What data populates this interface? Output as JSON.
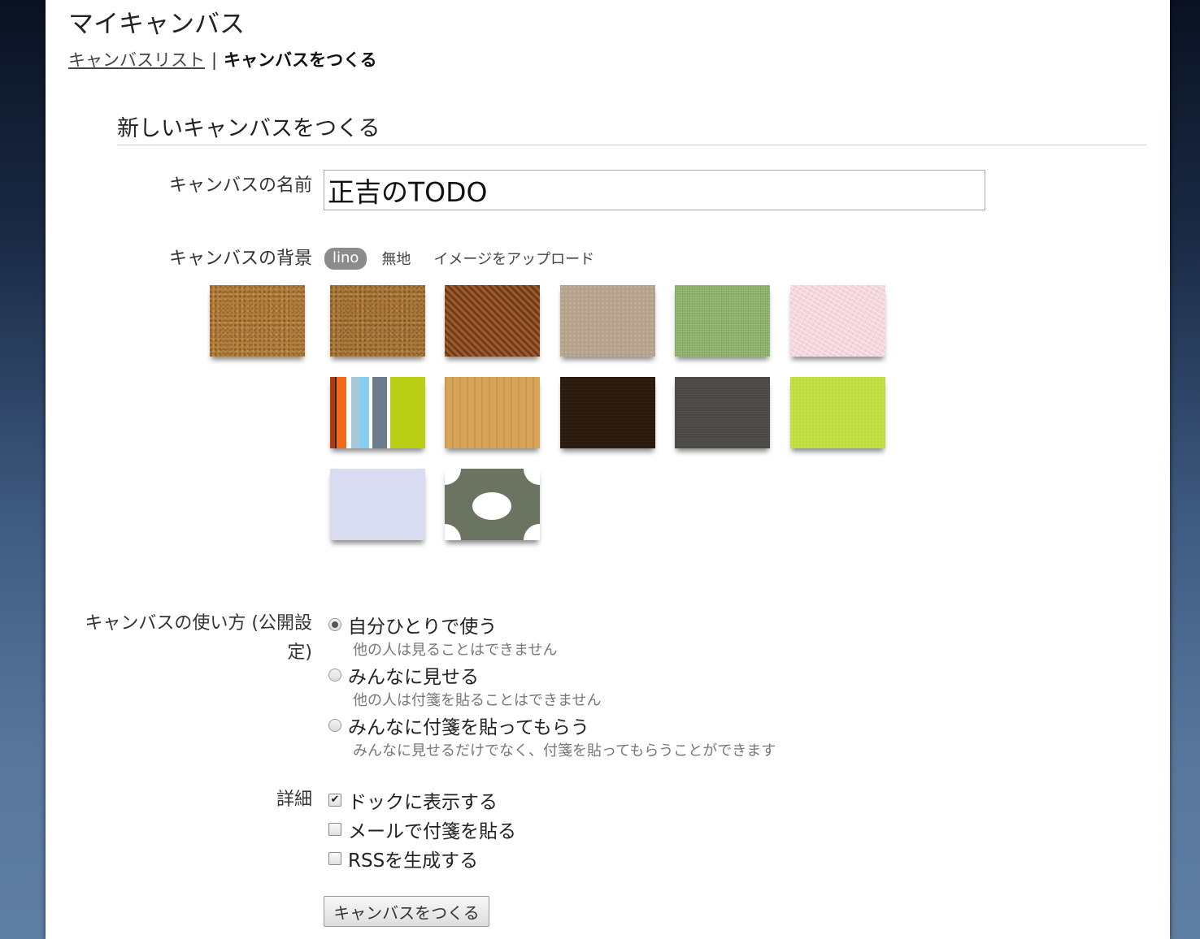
{
  "header": {
    "title": "マイキャンバス",
    "breadcrumb": {
      "link": "キャンバスリスト",
      "separator": "|",
      "current": "キャンバスをつくる"
    }
  },
  "form": {
    "section_title": "新しいキャンバスをつくる",
    "name": {
      "label": "キャンバスの名前",
      "value": "正吉のTODO"
    },
    "background": {
      "label": "キャンバスの背景",
      "tabs": [
        "lino",
        "無地",
        "イメージをアップロード"
      ],
      "active_tab": "lino",
      "swatches": [
        "cork",
        "cork-dark",
        "brown-stripes",
        "kraft",
        "green-cloth",
        "pink-pattern",
        "multi-stripes",
        "light-wood",
        "dark-brown",
        "charcoal",
        "lime",
        "lavender",
        "polka-dots"
      ]
    },
    "usage": {
      "label": "キャンバスの使い方 (公開設定)",
      "options": [
        {
          "label": "自分ひとりで使う",
          "desc": "他の人は見ることはできません",
          "checked": true
        },
        {
          "label": "みんなに見せる",
          "desc": "他の人は付箋を貼ることはできません",
          "checked": false
        },
        {
          "label": "みんなに付箋を貼ってもらう",
          "desc": "みんなに見せるだけでなく、付箋を貼ってもらうことができます",
          "checked": false
        }
      ]
    },
    "details": {
      "label": "詳細",
      "options": [
        {
          "label": "ドックに表示する",
          "checked": true,
          "mark": "✔"
        },
        {
          "label": "メールで付箋を貼る",
          "checked": false
        },
        {
          "label": "RSSを生成する",
          "checked": false
        }
      ]
    },
    "submit_label": "キャンバスをつくる"
  }
}
